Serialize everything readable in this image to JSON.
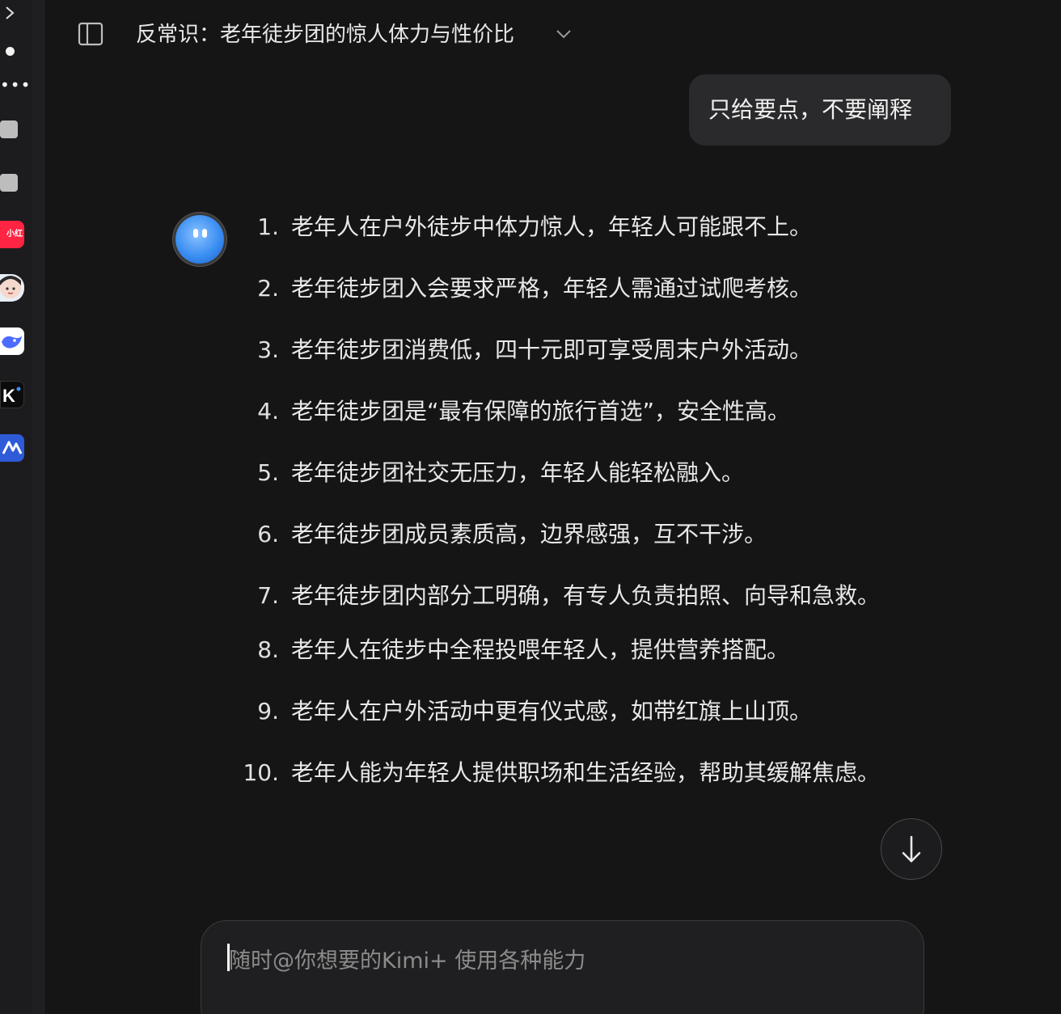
{
  "header": {
    "title": "反常识：老年徒步团的惊人体力与性价比"
  },
  "dock": {
    "xhs_label": "小红书"
  },
  "messages": {
    "user_text": "只给要点，不要阐释"
  },
  "answer": {
    "items": [
      {
        "num": "1.",
        "text": "老年人在户外徒步中体力惊人，年轻人可能跟不上。"
      },
      {
        "num": "2.",
        "text": "老年徒步团入会要求严格，年轻人需通过试爬考核。"
      },
      {
        "num": "3.",
        "text": "老年徒步团消费低，四十元即可享受周末户外活动。"
      },
      {
        "num": "4.",
        "text": "老年徒步团是“最有保障的旅行首选”，安全性高。"
      },
      {
        "num": "5.",
        "text": "老年徒步团社交无压力，年轻人能轻松融入。"
      },
      {
        "num": "6.",
        "text": "老年徒步团成员素质高，边界感强，互不干涉。"
      },
      {
        "num": "7.",
        "text": "老年徒步团内部分工明确，有专人负责拍照、向导和急救。"
      },
      {
        "num": "8.",
        "text": "老年人在徒步中全程投喂年轻人，提供营养搭配。"
      },
      {
        "num": "9.",
        "text": "老年人在户外活动中更有仪式感，如带红旗上山顶。"
      },
      {
        "num": "10.",
        "text": "老年人能为年轻人提供职场和生活经验，帮助其缓解焦虑。"
      }
    ]
  },
  "input": {
    "placeholder": "随时@你想要的Kimi+ 使用各种能力",
    "value": ""
  },
  "colors": {
    "background": "#151515",
    "bubble": "#2a2a2c",
    "accent_blue": "#3b8ff2",
    "xhs_red": "#ff2442"
  }
}
